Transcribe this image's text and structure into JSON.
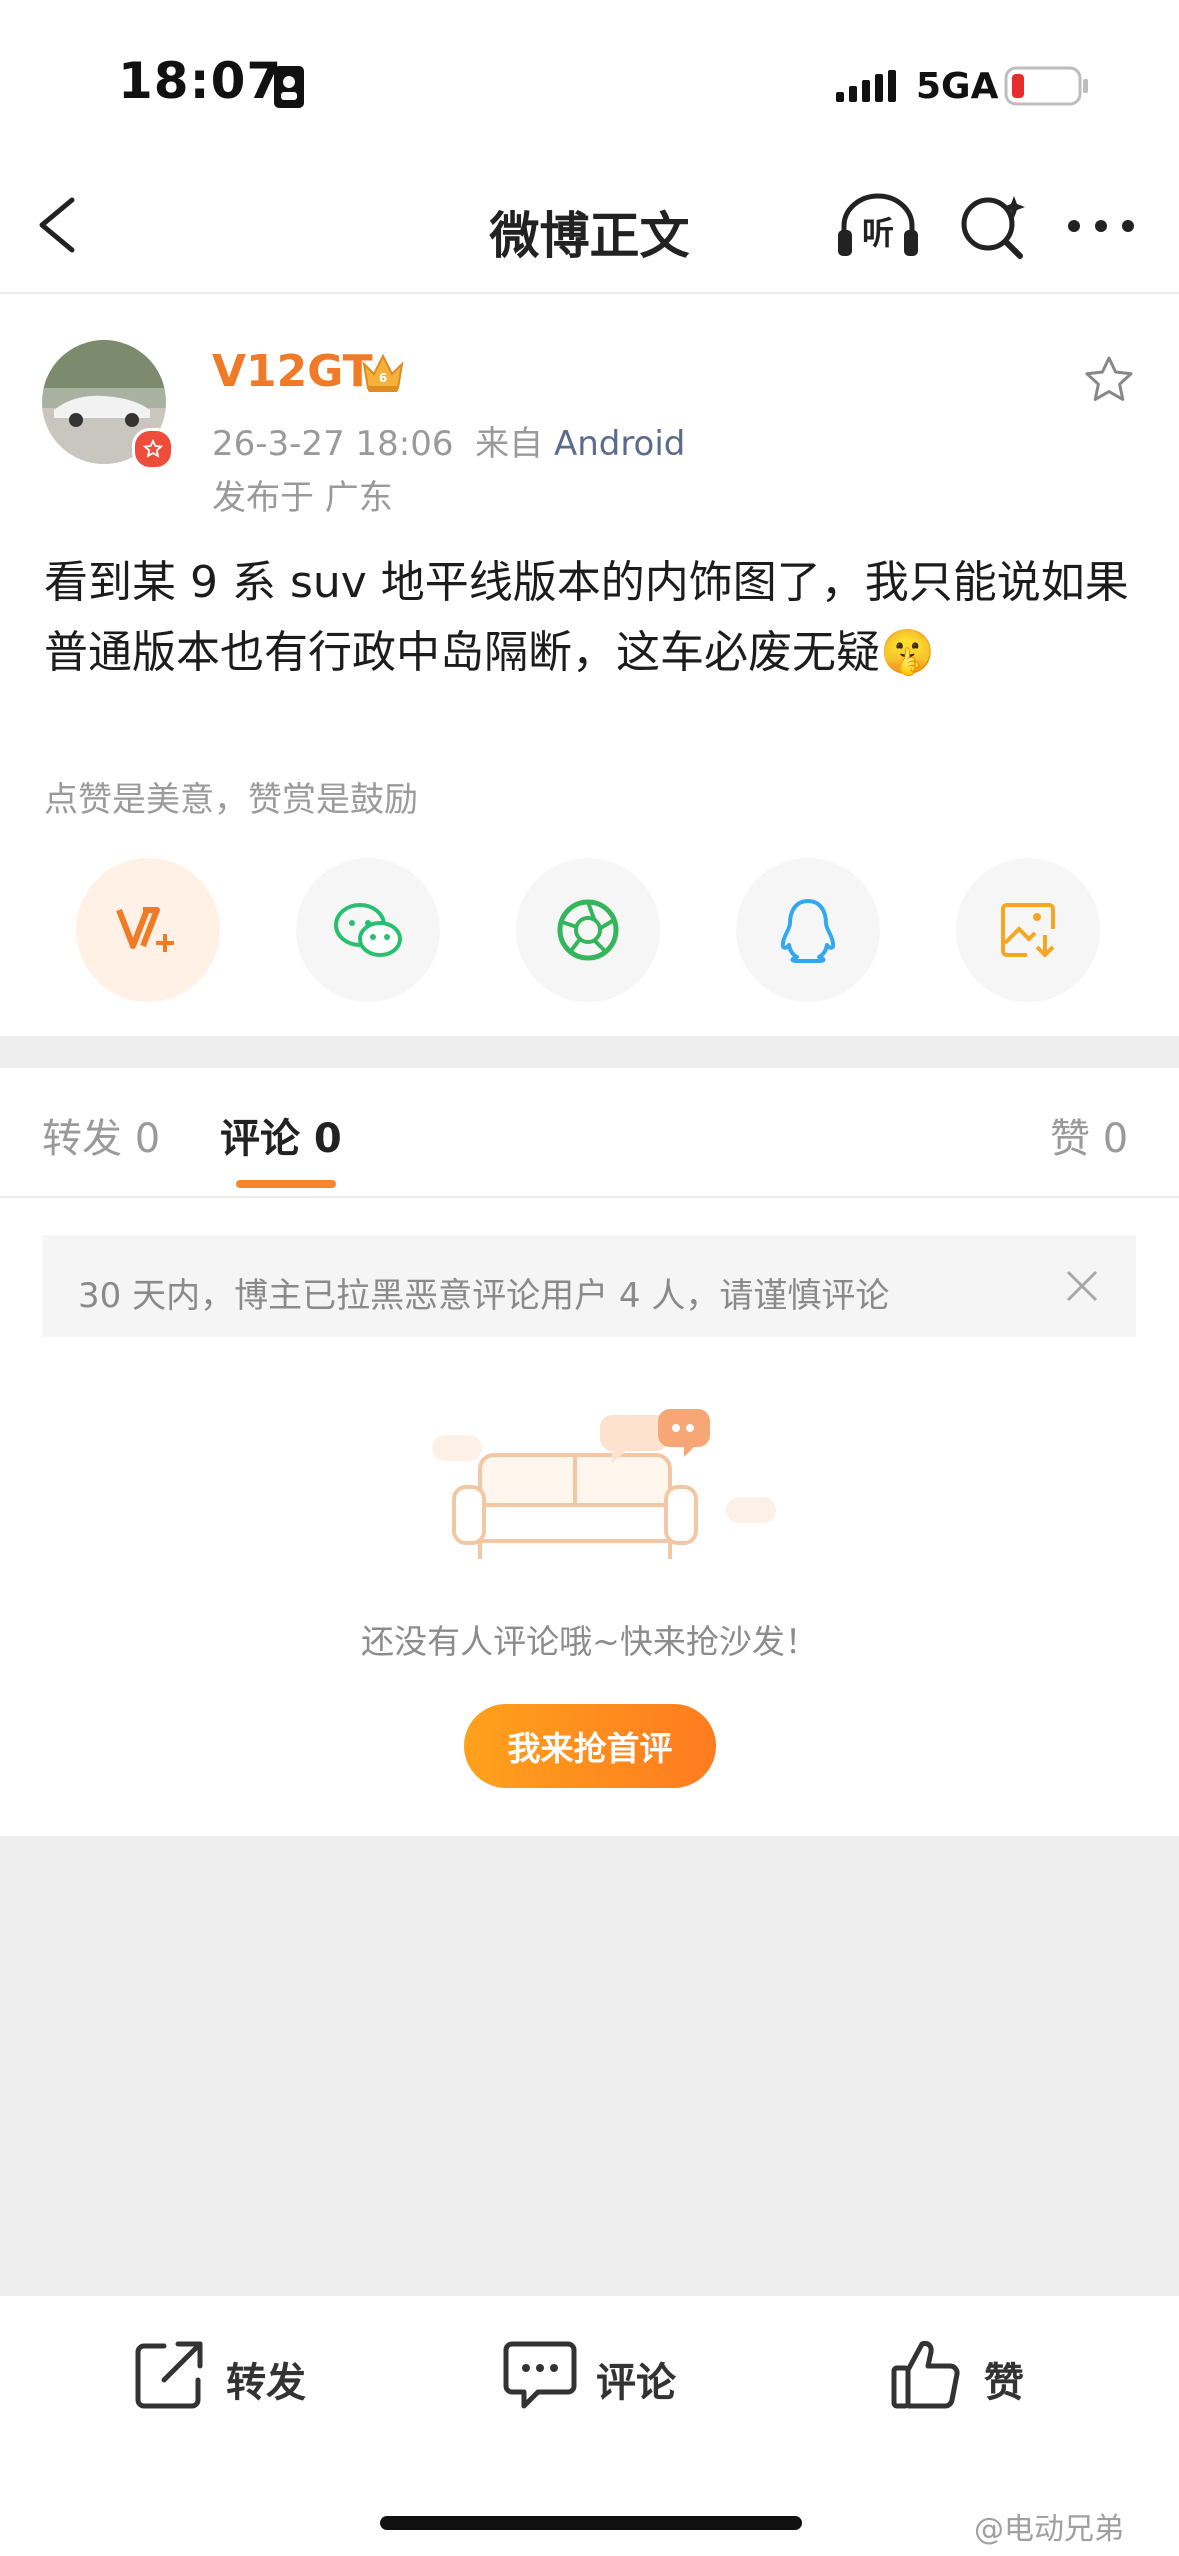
{
  "status_bar": {
    "time": "18:07",
    "network": "5GA"
  },
  "nav": {
    "title": "微博正文",
    "icons": [
      "back-icon",
      "listen-icon",
      "search-icon",
      "more-icon"
    ],
    "listen_label": "听"
  },
  "post": {
    "username": "V12GT",
    "timestamp": "26-3-27 18:06",
    "source_prefix": "来自",
    "source": "Android",
    "location": "发布于 广东",
    "text": "看到某 9 系 suv 地平线版本的内饰图了，我只能说如果普通版本也有行政中岛隔断，这车必废无疑",
    "emoji": "🤫",
    "reward_hint": "点赞是美意，赞赏是鼓励",
    "share_icons": [
      "reward-icon",
      "wechat-icon",
      "moments-icon",
      "qq-icon",
      "save-image-icon"
    ]
  },
  "tabs": {
    "repost": "转发 0",
    "comments": "评论 0",
    "likes": "赞 0"
  },
  "notice": {
    "text": "30 天内，博主已拉黑恶意评论用户 4 人，请谨慎评论"
  },
  "empty_state": {
    "message": "还没有人评论哦~快来抢沙发！",
    "button": "我来抢首评"
  },
  "bottom_bar": {
    "repost": "转发",
    "comment": "评论",
    "like": "赞"
  },
  "watermark": "@电动兄弟",
  "colors": {
    "accent": "#f07a26",
    "button_gradient_start": "#ffa11c",
    "button_gradient_end": "#ff7b1f",
    "source_link": "#5b6b8c"
  }
}
